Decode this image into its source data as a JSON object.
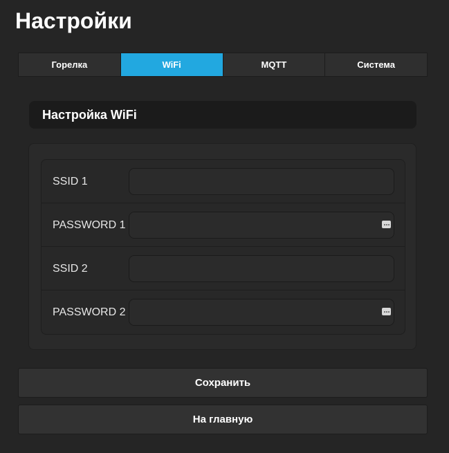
{
  "page": {
    "title": "Настройки"
  },
  "tabs": [
    {
      "label": "Горелка",
      "active": false
    },
    {
      "label": "WiFi",
      "active": true
    },
    {
      "label": "MQTT",
      "active": false
    },
    {
      "label": "Система",
      "active": false
    }
  ],
  "section": {
    "title": "Настройка WiFi"
  },
  "form": {
    "fields": [
      {
        "label": "SSID 1",
        "value": "",
        "type": "text"
      },
      {
        "label": "PASSWORD 1",
        "value": "",
        "type": "password",
        "icon": "password-manager-icon"
      },
      {
        "label": "SSID 2",
        "value": "",
        "type": "text"
      },
      {
        "label": "PASSWORD 2",
        "value": "",
        "type": "password",
        "icon": "password-manager-icon"
      }
    ]
  },
  "buttons": {
    "save_label": "Сохранить",
    "home_label": "На главную"
  },
  "colors": {
    "background": "#252525",
    "accent": "#22a8e0",
    "panel": "#1b1b1b",
    "text": "#ffffff"
  }
}
